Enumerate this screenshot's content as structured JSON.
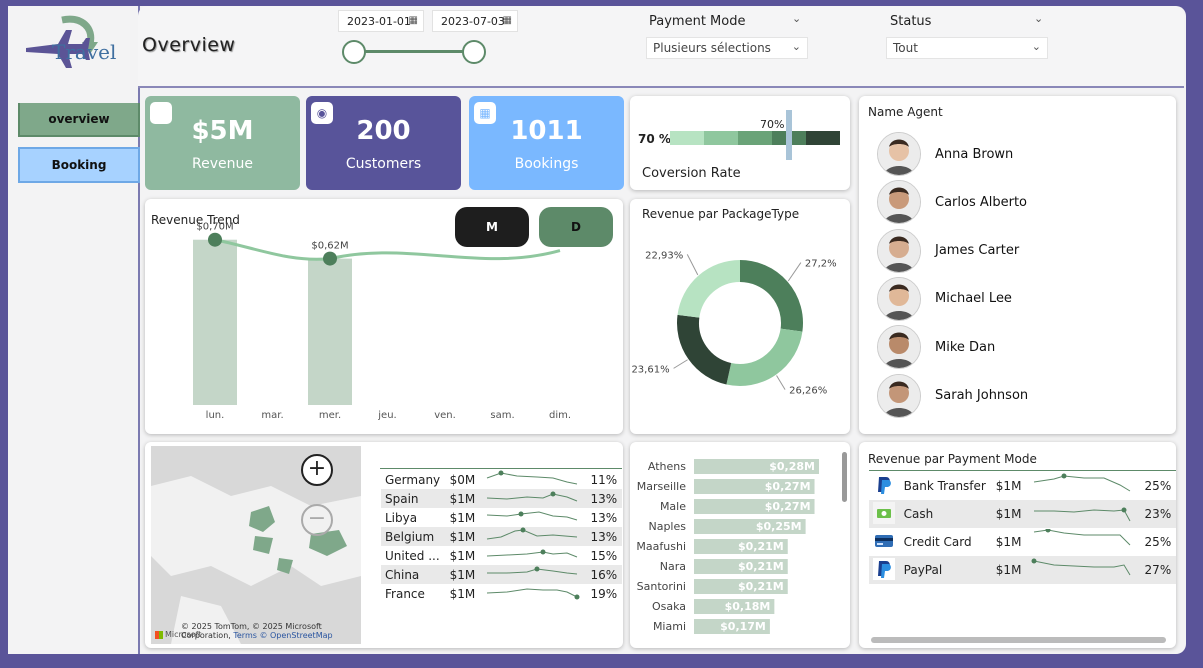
{
  "app": {
    "logo_text": "Travel"
  },
  "nav": {
    "items": [
      {
        "label": "overview"
      },
      {
        "label": "Booking"
      }
    ]
  },
  "header": {
    "title": "Overview",
    "date_start": "2023-01-01",
    "date_end": "2023-07-03",
    "payment_mode": {
      "label": "Payment Mode",
      "value": "Plusieurs sélections"
    },
    "status": {
      "label": "Status",
      "value": "Tout"
    }
  },
  "kpis": [
    {
      "value": "$5M",
      "label": "Revenue",
      "color": "#8fb9a0",
      "icon": "chart-icon"
    },
    {
      "value": "200",
      "label": "Customers",
      "color": "#58549a",
      "icon": "people-icon"
    },
    {
      "value": "1011",
      "label": "Bookings",
      "color": "#7ab8ff",
      "icon": "calendar-icon"
    }
  ],
  "conversion": {
    "title": "Coversion Rate",
    "value_label": "70 %",
    "marker_label": "70%",
    "value": 70
  },
  "revenue_trend": {
    "title": "Revenue Trend",
    "buttons": [
      "M",
      "D"
    ],
    "days": [
      "lun.",
      "mar.",
      "mer.",
      "jeu.",
      "ven.",
      "sam.",
      "dim."
    ],
    "bars": [
      0.7,
      0,
      0.62,
      0,
      0,
      0,
      0
    ],
    "labels": [
      "$0,70M",
      "",
      "$0,62M",
      "",
      "",
      "",
      ""
    ]
  },
  "package": {
    "title": "Revenue par PackageType",
    "slices": [
      {
        "label": "27,2%",
        "value": 27.2,
        "color": "#4d7f5b"
      },
      {
        "label": "26,26%",
        "value": 26.26,
        "color": "#8fc79e"
      },
      {
        "label": "23,61%",
        "value": 23.61,
        "color": "#2f4436"
      },
      {
        "label": "22,93%",
        "value": 22.93,
        "color": "#b7e3c2"
      }
    ]
  },
  "agents": {
    "title": "Name Agent",
    "list": [
      "Anna Brown",
      "Carlos Alberto",
      "James Carter",
      "Michael Lee",
      "Mike Dan",
      "Sarah Johnson"
    ]
  },
  "map": {
    "attribution": "© 2025 TomTom, © 2025 Microsoft Corporation,",
    "osm": "© OpenStreetMap",
    "terms": "Terms",
    "brand": "Microsoft"
  },
  "countries": [
    {
      "name": "Germany",
      "rev": "$0M",
      "pct": "11%"
    },
    {
      "name": "Spain",
      "rev": "$1M",
      "pct": "13%"
    },
    {
      "name": "Libya",
      "rev": "$1M",
      "pct": "13%"
    },
    {
      "name": "Belgium",
      "rev": "$1M",
      "pct": "13%"
    },
    {
      "name": "United ...",
      "rev": "$1M",
      "pct": "15%"
    },
    {
      "name": "China",
      "rev": "$1M",
      "pct": "16%"
    },
    {
      "name": "France",
      "rev": "$1M",
      "pct": "19%"
    }
  ],
  "cities": [
    {
      "name": "Athens",
      "label": "$0,28M",
      "value": 0.28
    },
    {
      "name": "Marseille",
      "label": "$0,27M",
      "value": 0.27
    },
    {
      "name": "Male",
      "label": "$0,27M",
      "value": 0.27
    },
    {
      "name": "Naples",
      "label": "$0,25M",
      "value": 0.25
    },
    {
      "name": "Maafushi",
      "label": "$0,21M",
      "value": 0.21
    },
    {
      "name": "Nara",
      "label": "$0,21M",
      "value": 0.21
    },
    {
      "name": "Santorini",
      "label": "$0,21M",
      "value": 0.21
    },
    {
      "name": "Osaka",
      "label": "$0,18M",
      "value": 0.18
    },
    {
      "name": "Miami",
      "label": "$0,17M",
      "value": 0.17
    }
  ],
  "payments": {
    "title": "Revenue par Payment Mode",
    "rows": [
      {
        "name": "Bank Transfer",
        "rev": "$1M",
        "pct": "25%",
        "icon": "paypal-icon"
      },
      {
        "name": "Cash",
        "rev": "$1M",
        "pct": "23%",
        "icon": "cash-icon"
      },
      {
        "name": "Credit Card",
        "rev": "$1M",
        "pct": "25%",
        "icon": "credit-card-icon"
      },
      {
        "name": "PayPal",
        "rev": "$1M",
        "pct": "27%",
        "icon": "paypal-icon"
      }
    ]
  }
}
